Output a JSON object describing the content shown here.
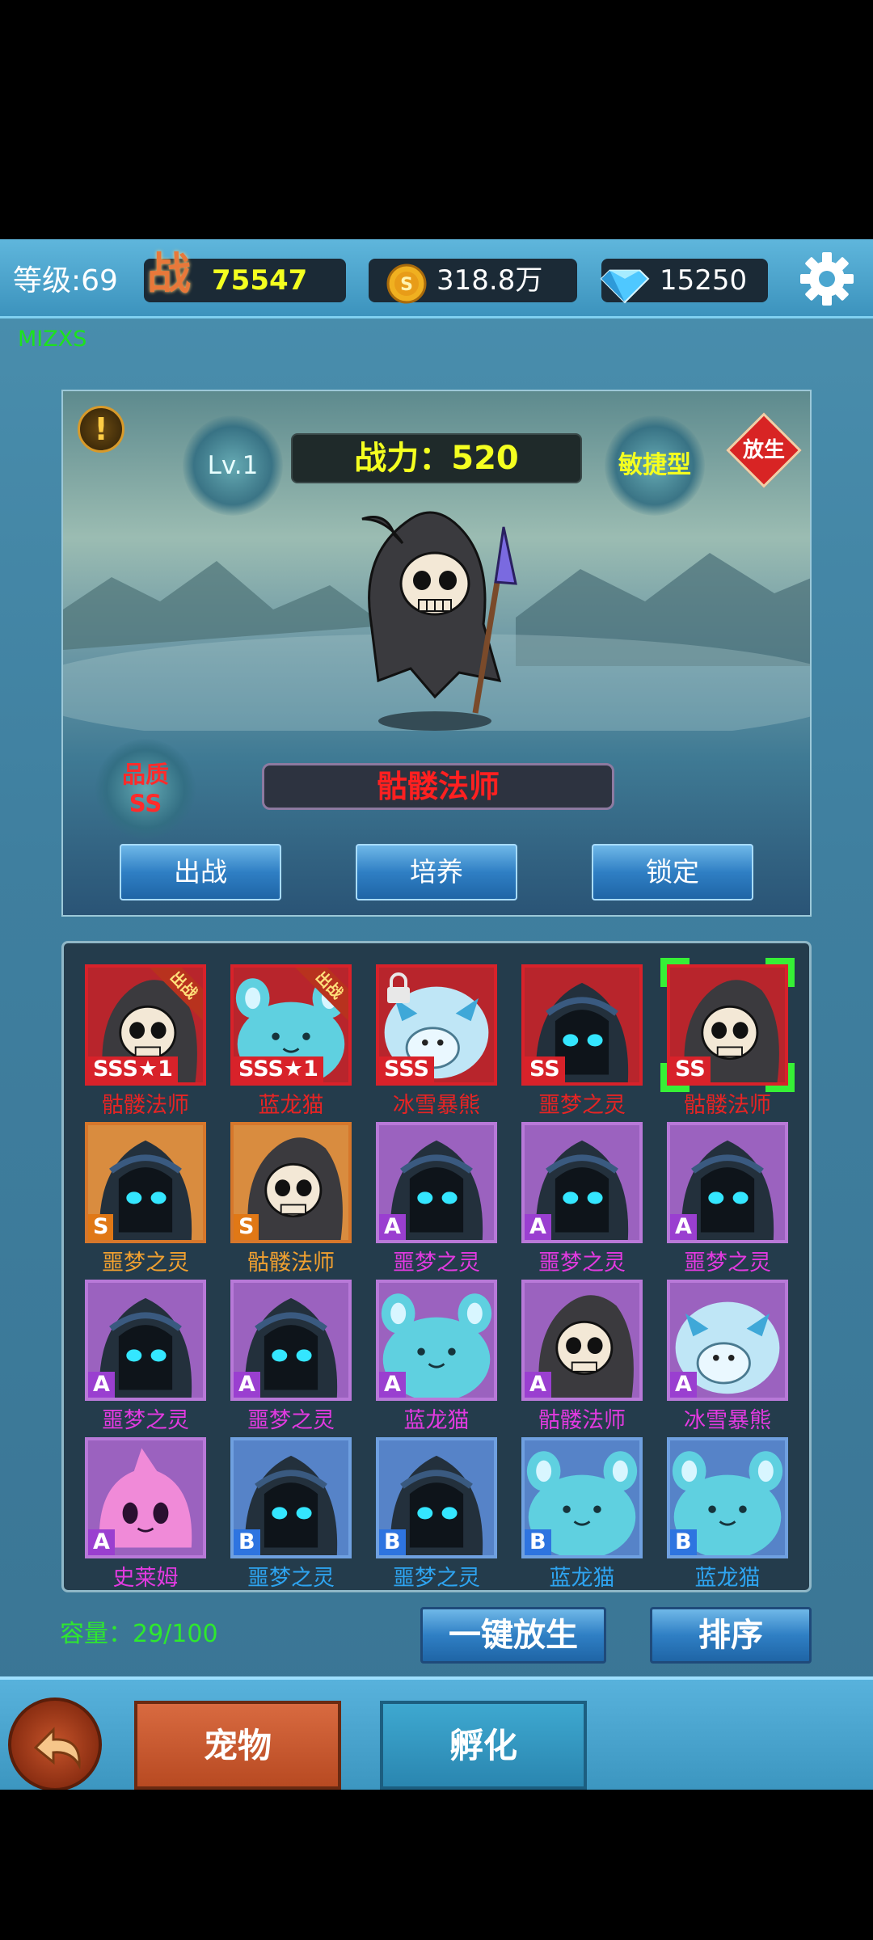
{
  "topbar": {
    "level_label": "等级:69",
    "battle_icon_text": "战",
    "battle_value": "75547",
    "gold_value": "318.8万",
    "gem_value": "15250",
    "tag": "MIZXS"
  },
  "hero": {
    "level": "Lv.1",
    "power": "战力：520",
    "type": "敏捷型",
    "release": "放生",
    "quality_label": "品质",
    "quality_value": "SS",
    "name": "骷髅法师",
    "buttons": [
      "出战",
      "培养",
      "锁定"
    ]
  },
  "pets": [
    {
      "name": "骷髅法师",
      "grade": "SSS★1",
      "tier": "sss",
      "kind": "skull",
      "tag": "出战"
    },
    {
      "name": "蓝龙猫",
      "grade": "SSS★1",
      "tier": "sss",
      "kind": "cat",
      "tag": "出战"
    },
    {
      "name": "冰雪暴熊",
      "grade": "SSS",
      "tier": "sss",
      "kind": "bear",
      "locked": true
    },
    {
      "name": "噩梦之灵",
      "grade": "SS",
      "tier": "ss",
      "kind": "ghost"
    },
    {
      "name": "骷髅法师",
      "grade": "SS",
      "tier": "ss",
      "kind": "skull",
      "selected": true
    },
    {
      "name": "噩梦之灵",
      "grade": "S",
      "tier": "s",
      "kind": "ghost"
    },
    {
      "name": "骷髅法师",
      "grade": "S",
      "tier": "s",
      "kind": "skull"
    },
    {
      "name": "噩梦之灵",
      "grade": "A",
      "tier": "a",
      "kind": "ghost"
    },
    {
      "name": "噩梦之灵",
      "grade": "A",
      "tier": "a",
      "kind": "ghost"
    },
    {
      "name": "噩梦之灵",
      "grade": "A",
      "tier": "a",
      "kind": "ghost"
    },
    {
      "name": "噩梦之灵",
      "grade": "A",
      "tier": "a",
      "kind": "ghost"
    },
    {
      "name": "噩梦之灵",
      "grade": "A",
      "tier": "a",
      "kind": "ghost"
    },
    {
      "name": "蓝龙猫",
      "grade": "A",
      "tier": "a",
      "kind": "cat"
    },
    {
      "name": "骷髅法师",
      "grade": "A",
      "tier": "a",
      "kind": "skull"
    },
    {
      "name": "冰雪暴熊",
      "grade": "A",
      "tier": "a",
      "kind": "bear"
    },
    {
      "name": "史莱姆",
      "grade": "A",
      "tier": "a",
      "kind": "slime"
    },
    {
      "name": "噩梦之灵",
      "grade": "B",
      "tier": "b",
      "kind": "ghost"
    },
    {
      "name": "噩梦之灵",
      "grade": "B",
      "tier": "b",
      "kind": "ghost"
    },
    {
      "name": "蓝龙猫",
      "grade": "B",
      "tier": "b",
      "kind": "cat"
    },
    {
      "name": "蓝龙猫",
      "grade": "B",
      "tier": "b",
      "kind": "cat"
    }
  ],
  "capacity": "容量：29/100",
  "actions": {
    "release_all": "一键放生",
    "sort": "排序"
  },
  "tabs": {
    "pets": "宠物",
    "hatch": "孵化"
  }
}
